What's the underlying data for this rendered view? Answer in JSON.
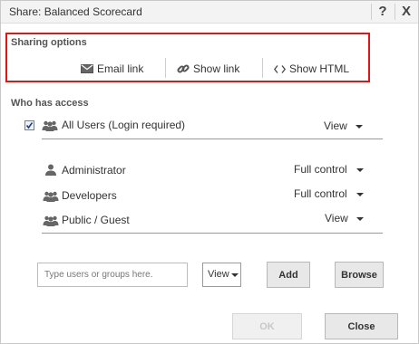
{
  "title": "Share: Balanced Scorecard",
  "titlebar": {
    "help_label": "?",
    "close_label": "X"
  },
  "sharing": {
    "heading": "Sharing options",
    "email_link_label": "Email link",
    "show_link_label": "Show link",
    "show_html_label": "Show HTML",
    "highlight_color": "#e01515"
  },
  "access": {
    "heading": "Who has access",
    "all_users": {
      "label": "All Users (Login required)",
      "permission": "View",
      "checked": true
    },
    "entries": [
      {
        "icon": "user-icon",
        "name": "Administrator",
        "permission": "Full control"
      },
      {
        "icon": "group-icon",
        "name": "Developers",
        "permission": "Full control"
      },
      {
        "icon": "group-icon",
        "name": "Public / Guest",
        "permission": "View"
      }
    ]
  },
  "add": {
    "input_placeholder": "Type users or groups here.",
    "input_value": "",
    "permission_selected": "View",
    "add_label": "Add",
    "browse_label": "Browse"
  },
  "footer": {
    "ok_label": "OK",
    "close_label": "Close"
  }
}
